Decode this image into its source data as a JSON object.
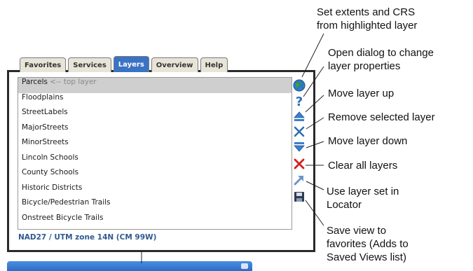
{
  "tabs": [
    {
      "label": "Favorites",
      "active": false
    },
    {
      "label": "Services",
      "active": false
    },
    {
      "label": "Layers",
      "active": true
    },
    {
      "label": "Overview",
      "active": false
    },
    {
      "label": "Help",
      "active": false
    }
  ],
  "layers": [
    {
      "name": "Parcels",
      "note": "<-- top layer",
      "selected": true
    },
    {
      "name": "Floodplains"
    },
    {
      "name": "StreetLabels"
    },
    {
      "name": "MajorStreets"
    },
    {
      "name": "MinorStreets"
    },
    {
      "name": "Lincoln Schools"
    },
    {
      "name": "County Schools"
    },
    {
      "name": "Historic Districts"
    },
    {
      "name": "Bicycle/Pedestrian Trails"
    },
    {
      "name": "Onstreet Bicycle Trails"
    }
  ],
  "crs_text": "NAD27 / UTM zone 14N (CM 99W)",
  "icons": [
    {
      "name": "globe-icon",
      "glyph": "globe"
    },
    {
      "name": "help-icon",
      "glyph": "?"
    },
    {
      "name": "move-up-icon",
      "glyph": "up"
    },
    {
      "name": "remove-icon",
      "glyph": "x-blue"
    },
    {
      "name": "move-down-icon",
      "glyph": "down"
    },
    {
      "name": "clear-icon",
      "glyph": "x-red"
    },
    {
      "name": "locator-icon",
      "glyph": "arrow"
    },
    {
      "name": "save-icon",
      "glyph": "floppy"
    }
  ],
  "callouts": {
    "extents": [
      "Set extents and CRS",
      "from highlighted layer"
    ],
    "properties": [
      "Open dialog to change",
      "layer properties"
    ],
    "move_up": [
      "Move layer up"
    ],
    "remove": [
      "Remove selected layer"
    ],
    "move_down": [
      "Move layer down"
    ],
    "clear": [
      "Clear all layers"
    ],
    "locator": [
      "Use layer set in",
      "Locator"
    ],
    "save": [
      "Save view to",
      "favorites (Adds to",
      "Saved Views list)"
    ]
  },
  "colors": {
    "accent": "#3b73c4",
    "crs_text": "#2f5a8f",
    "clear_red": "#d42020",
    "remove_blue": "#2f6fb5"
  }
}
